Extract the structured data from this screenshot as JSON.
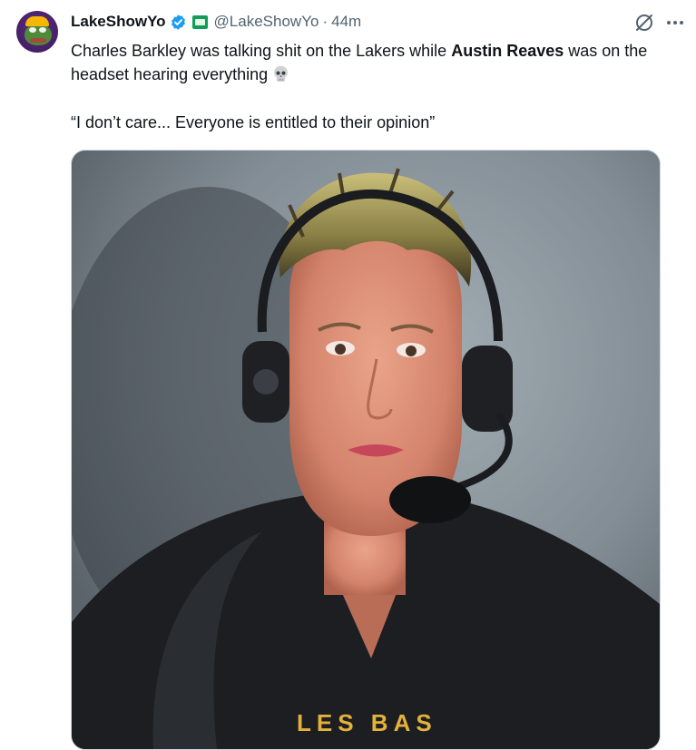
{
  "author": {
    "display_name": "LakeShowYo",
    "handle": "@LakeShowYo",
    "separator": "·",
    "timestamp": "44m",
    "verified": true
  },
  "tweet": {
    "text_part1": "Charles Barkley was talking shit on the Lakers while ",
    "text_bold": "Austin Reaves",
    "text_part2": " was on the headset hearing everything",
    "emoji_icon": "skull-emoji",
    "quote": "“I don’t care... Everyone is entitled to their opinion”"
  },
  "media": {
    "hoodie_text": "LES BAS"
  },
  "colors": {
    "primary_text": "#0f1419",
    "secondary_text": "#536471",
    "verified_blue": "#1d9bf0",
    "affiliate_green": "#0f9d58"
  }
}
